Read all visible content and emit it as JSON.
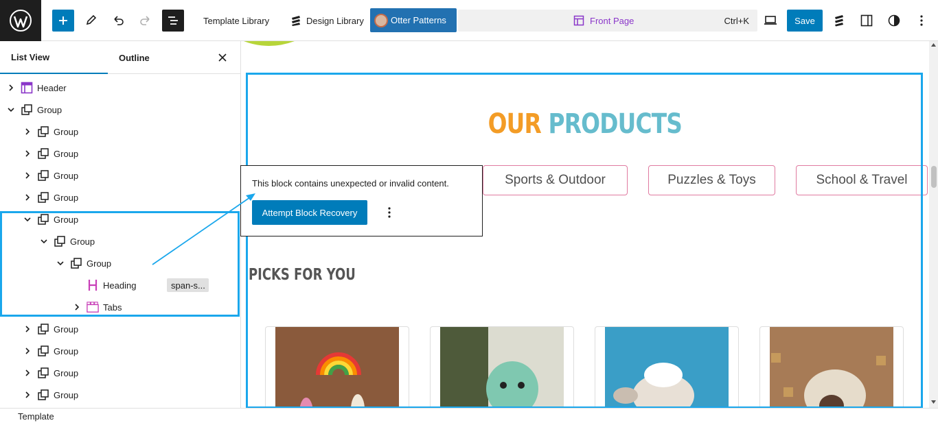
{
  "toolbar": {
    "template_library": "Template Library",
    "design_library": "Design Library",
    "otter_patterns": "Otter Patterns",
    "page_title": "Front Page",
    "shortcut": "Ctrl+K",
    "save": "Save"
  },
  "sidebar": {
    "tab_list_view": "List View",
    "tab_outline": "Outline",
    "items": [
      {
        "label": "Header"
      },
      {
        "label": "Group"
      },
      {
        "label": "Group"
      },
      {
        "label": "Group"
      },
      {
        "label": "Group"
      },
      {
        "label": "Group"
      },
      {
        "label": "Group"
      },
      {
        "label": "Group"
      },
      {
        "label": "Group"
      },
      {
        "label": "Heading",
        "badge": "span-s..."
      },
      {
        "label": "Tabs"
      },
      {
        "label": "Group"
      },
      {
        "label": "Group"
      },
      {
        "label": "Group"
      },
      {
        "label": "Group"
      }
    ]
  },
  "canvas": {
    "heading_part1": "OUR",
    "heading_part2": "PRODUCTS",
    "tabs": [
      "Sports & Outdoor",
      "Puzzles & Toys",
      "School & Travel"
    ],
    "picks_heading": "PICKS FOR YOU"
  },
  "popup": {
    "message": "This block contains unexpected or invalid content.",
    "recover_button": "Attempt Block Recovery"
  },
  "footer": {
    "breadcrumb": "Template"
  },
  "colors": {
    "accent": "#007cba",
    "selection": "#1aa7ec",
    "heading_orange": "#f39c26",
    "heading_teal": "#66bccd",
    "tab_border": "#e07aa0"
  }
}
